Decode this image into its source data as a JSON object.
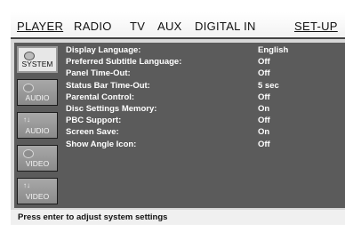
{
  "tabs": [
    {
      "label": "PLAYER"
    },
    {
      "label": "RADIO"
    },
    {
      "label": "TV"
    },
    {
      "label": "AUX"
    },
    {
      "label": "DIGITAL IN"
    },
    {
      "label": "SET-UP"
    }
  ],
  "sidebar": {
    "items": [
      {
        "label": "SYSTEM",
        "icon": "disc-icon"
      },
      {
        "label": "AUDIO",
        "icon": "disc-icon"
      },
      {
        "label": "AUDIO",
        "icon": "sliders-icon"
      },
      {
        "label": "VIDEO",
        "icon": "disc-icon"
      },
      {
        "label": "VIDEO",
        "icon": "sliders-icon"
      }
    ]
  },
  "settings": [
    {
      "label": "Display Language:",
      "value": "English"
    },
    {
      "label": "Preferred Subtitle Language:",
      "value": "Off"
    },
    {
      "label": "Panel Time-Out:",
      "value": "Off"
    },
    {
      "label": "Status Bar Time-Out:",
      "value": "5 sec"
    },
    {
      "label": "Parental Control:",
      "value": "Off"
    },
    {
      "label": "Disc Settings Memory:",
      "value": "On"
    },
    {
      "label": "PBC Support:",
      "value": "Off"
    },
    {
      "label": "Screen Save:",
      "value": "On"
    },
    {
      "label": "Show Angle Icon:",
      "value": "Off"
    }
  ],
  "status_text": "Press enter to adjust system settings"
}
